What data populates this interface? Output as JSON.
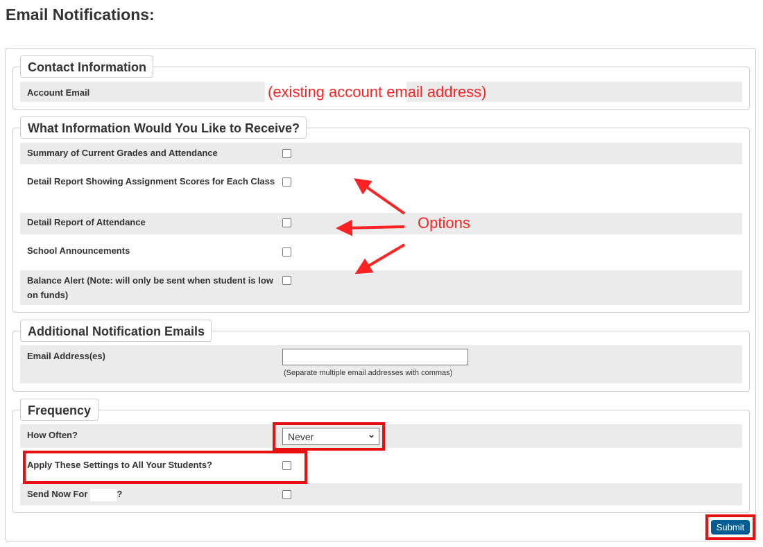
{
  "page_title": "Email Notifications:",
  "contact": {
    "legend": "Contact Information",
    "account_email_label": "Account Email",
    "account_email_annotation": "(existing account email address)"
  },
  "receive": {
    "legend": "What Information Would You Like to Receive?",
    "options": [
      {
        "label": "Summary of Current Grades and Attendance",
        "checked": false
      },
      {
        "label": "Detail Report Showing Assignment Scores for Each Class",
        "checked": false
      },
      {
        "label": "Detail Report of Attendance",
        "checked": false
      },
      {
        "label": "School Announcements",
        "checked": false
      },
      {
        "label": "Balance Alert (Note: will only be sent when student is low on funds)",
        "checked": false
      }
    ],
    "annotation": "Options"
  },
  "additional": {
    "legend": "Additional Notification Emails",
    "email_label": "Email Address(es)",
    "email_value": "",
    "hint": "(Separate multiple email addresses with commas)"
  },
  "frequency": {
    "legend": "Frequency",
    "how_often_label": "How Often?",
    "how_often_value": "Never",
    "apply_all_label": "Apply These Settings to All Your Students?",
    "send_now_label": "Send Now For",
    "send_now_suffix": "?"
  },
  "submit_label": "Submit",
  "colors": {
    "annotation": "#f22222",
    "submit_bg": "#005d94",
    "row_gray": "#ebebeb"
  }
}
